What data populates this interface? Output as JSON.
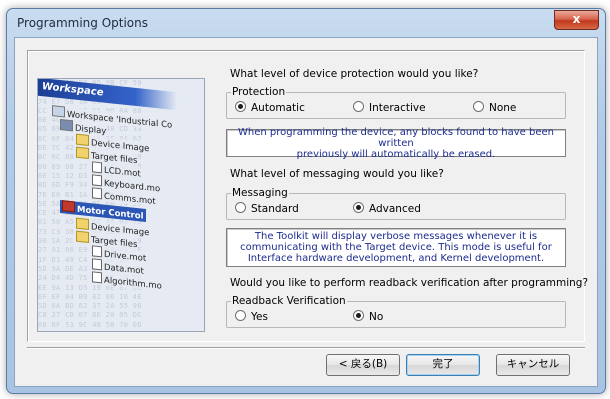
{
  "window": {
    "title": "Programming Options",
    "close_label": "x"
  },
  "illustration": {
    "workspace_label": "Workspace",
    "tree": [
      {
        "label": "Workspace 'Industrial Co",
        "icon": "workspace-icon"
      },
      {
        "label": "Display",
        "icon": "display-icon"
      },
      {
        "label": "Device Image",
        "icon": "folder-icon"
      },
      {
        "label": "Target files",
        "icon": "folder-icon"
      },
      {
        "label": "LCD.mot",
        "icon": "file-icon"
      },
      {
        "label": "Keyboard.mo",
        "icon": "file-icon"
      },
      {
        "label": "Comms.mot",
        "icon": "file-icon"
      },
      {
        "label": "Motor Control",
        "icon": "motor-icon"
      },
      {
        "label": "Device Image",
        "icon": "folder-icon"
      },
      {
        "label": "Target files",
        "icon": "folder-icon"
      },
      {
        "label": "Drive.mot",
        "icon": "file-icon"
      },
      {
        "label": "Data.mot",
        "icon": "file-icon"
      },
      {
        "label": "Algorithm.mo",
        "icon": "file-icon"
      }
    ]
  },
  "protection": {
    "question": "What level of device protection would you like?",
    "group_label": "Protection",
    "options": [
      "Automatic",
      "Interactive",
      "None"
    ],
    "selected": "Automatic",
    "note": "When programming the device, any blocks found to have been written\npreviously will automatically be erased."
  },
  "messaging": {
    "question": "What level of messaging would you like?",
    "group_label": "Messaging",
    "options": [
      "Standard",
      "Advanced"
    ],
    "selected": "Advanced",
    "note": "The Toolkit will display verbose messages whenever it is\ncommunicating with the Target device. This mode is useful for\nInterface hardware development, and Kernel development."
  },
  "readback": {
    "question": "Would you like to perform readback verification after programming?",
    "group_label": "Readback Verification",
    "options": [
      "Yes",
      "No"
    ],
    "selected": "No"
  },
  "buttons": {
    "back": "< 戻る(B)",
    "finish": "完了",
    "cancel": "キャンセル"
  }
}
